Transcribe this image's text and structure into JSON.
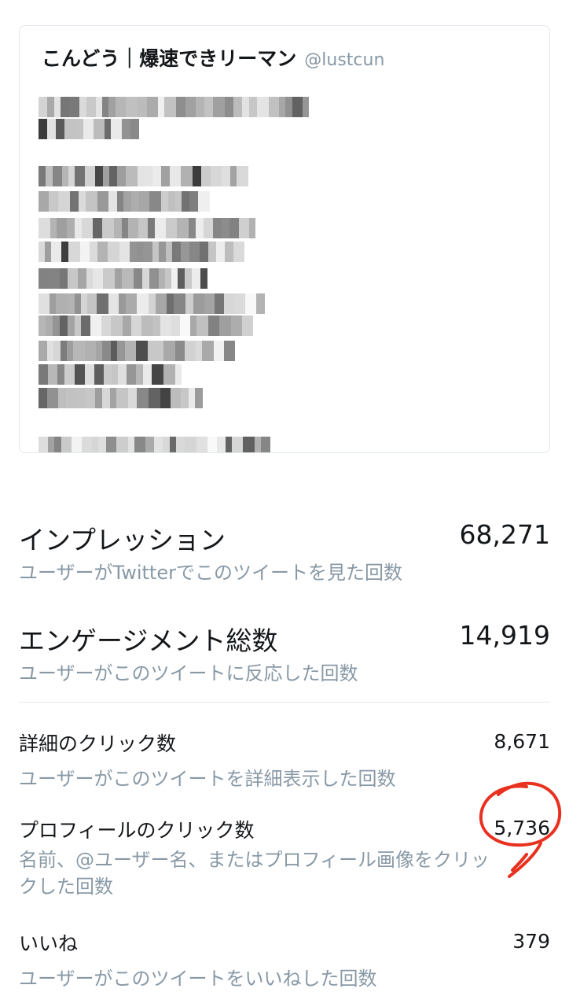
{
  "tweet": {
    "author_name": "こんどう｜爆速できリーマン",
    "author_handle": "@lustcun"
  },
  "metrics": [
    {
      "title": "インプレッション",
      "value": "68,271",
      "description": "ユーザーがTwitterでこのツイートを見た回数"
    },
    {
      "title": "エンゲージメント総数",
      "value": "14,919",
      "description": "ユーザーがこのツイートに反応した回数"
    },
    {
      "title": "詳細のクリック数",
      "value": "8,671",
      "description": "ユーザーがこのツイートを詳細表示した回数"
    },
    {
      "title": "プロフィールのクリック数",
      "value": "5,736",
      "description": "名前、@ユーザー名、またはプロフィール画像をクリックした回数"
    },
    {
      "title": "いいね",
      "value": "379",
      "description": "ユーザーがこのツイートをいいねした回数"
    }
  ],
  "colors": {
    "secondary_text": "#8899a6",
    "divider": "#e1e8ed",
    "annotation": "#e8321f"
  }
}
